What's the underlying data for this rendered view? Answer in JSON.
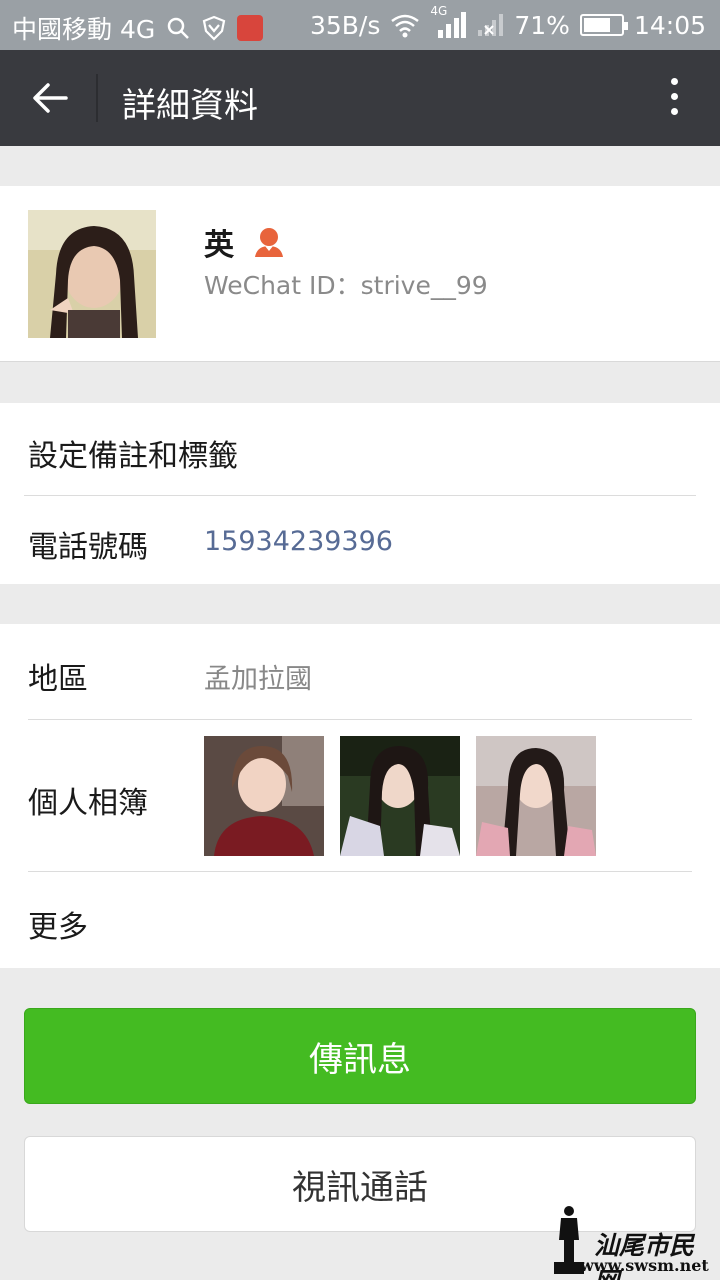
{
  "status_bar": {
    "carrier": "中國移動 4G",
    "net_speed": "35B/s",
    "mobile_tag": "4G",
    "battery_percent": "71%",
    "battery_level": 0.71,
    "time": "14:05"
  },
  "header": {
    "title": "詳細資料",
    "back_icon": "arrow-left-icon",
    "more_icon": "more-vertical-icon"
  },
  "profile": {
    "nickname": "英",
    "gender_icon": "female-user-icon",
    "gender_color": "#e8643c",
    "wechat_id": "WeChat ID：strive__99"
  },
  "contact_section": {
    "remark_label": "設定備註和標籤",
    "phone_label": "電話號碼",
    "phone_value": "15934239396",
    "phone_color": "#576b95"
  },
  "info_section": {
    "region_label": "地區",
    "region_value": "孟加拉國",
    "album_label": "個人相簿",
    "more_label": "更多"
  },
  "actions": {
    "send_message": "傳訊息",
    "video_call": "視訊通話"
  },
  "watermark": {
    "brand": "汕尾市民网",
    "url": "www.swsm.net"
  },
  "colors": {
    "header_bg": "#393a3f",
    "primary_green": "#44bb22",
    "page_bg": "#ebebeb"
  }
}
